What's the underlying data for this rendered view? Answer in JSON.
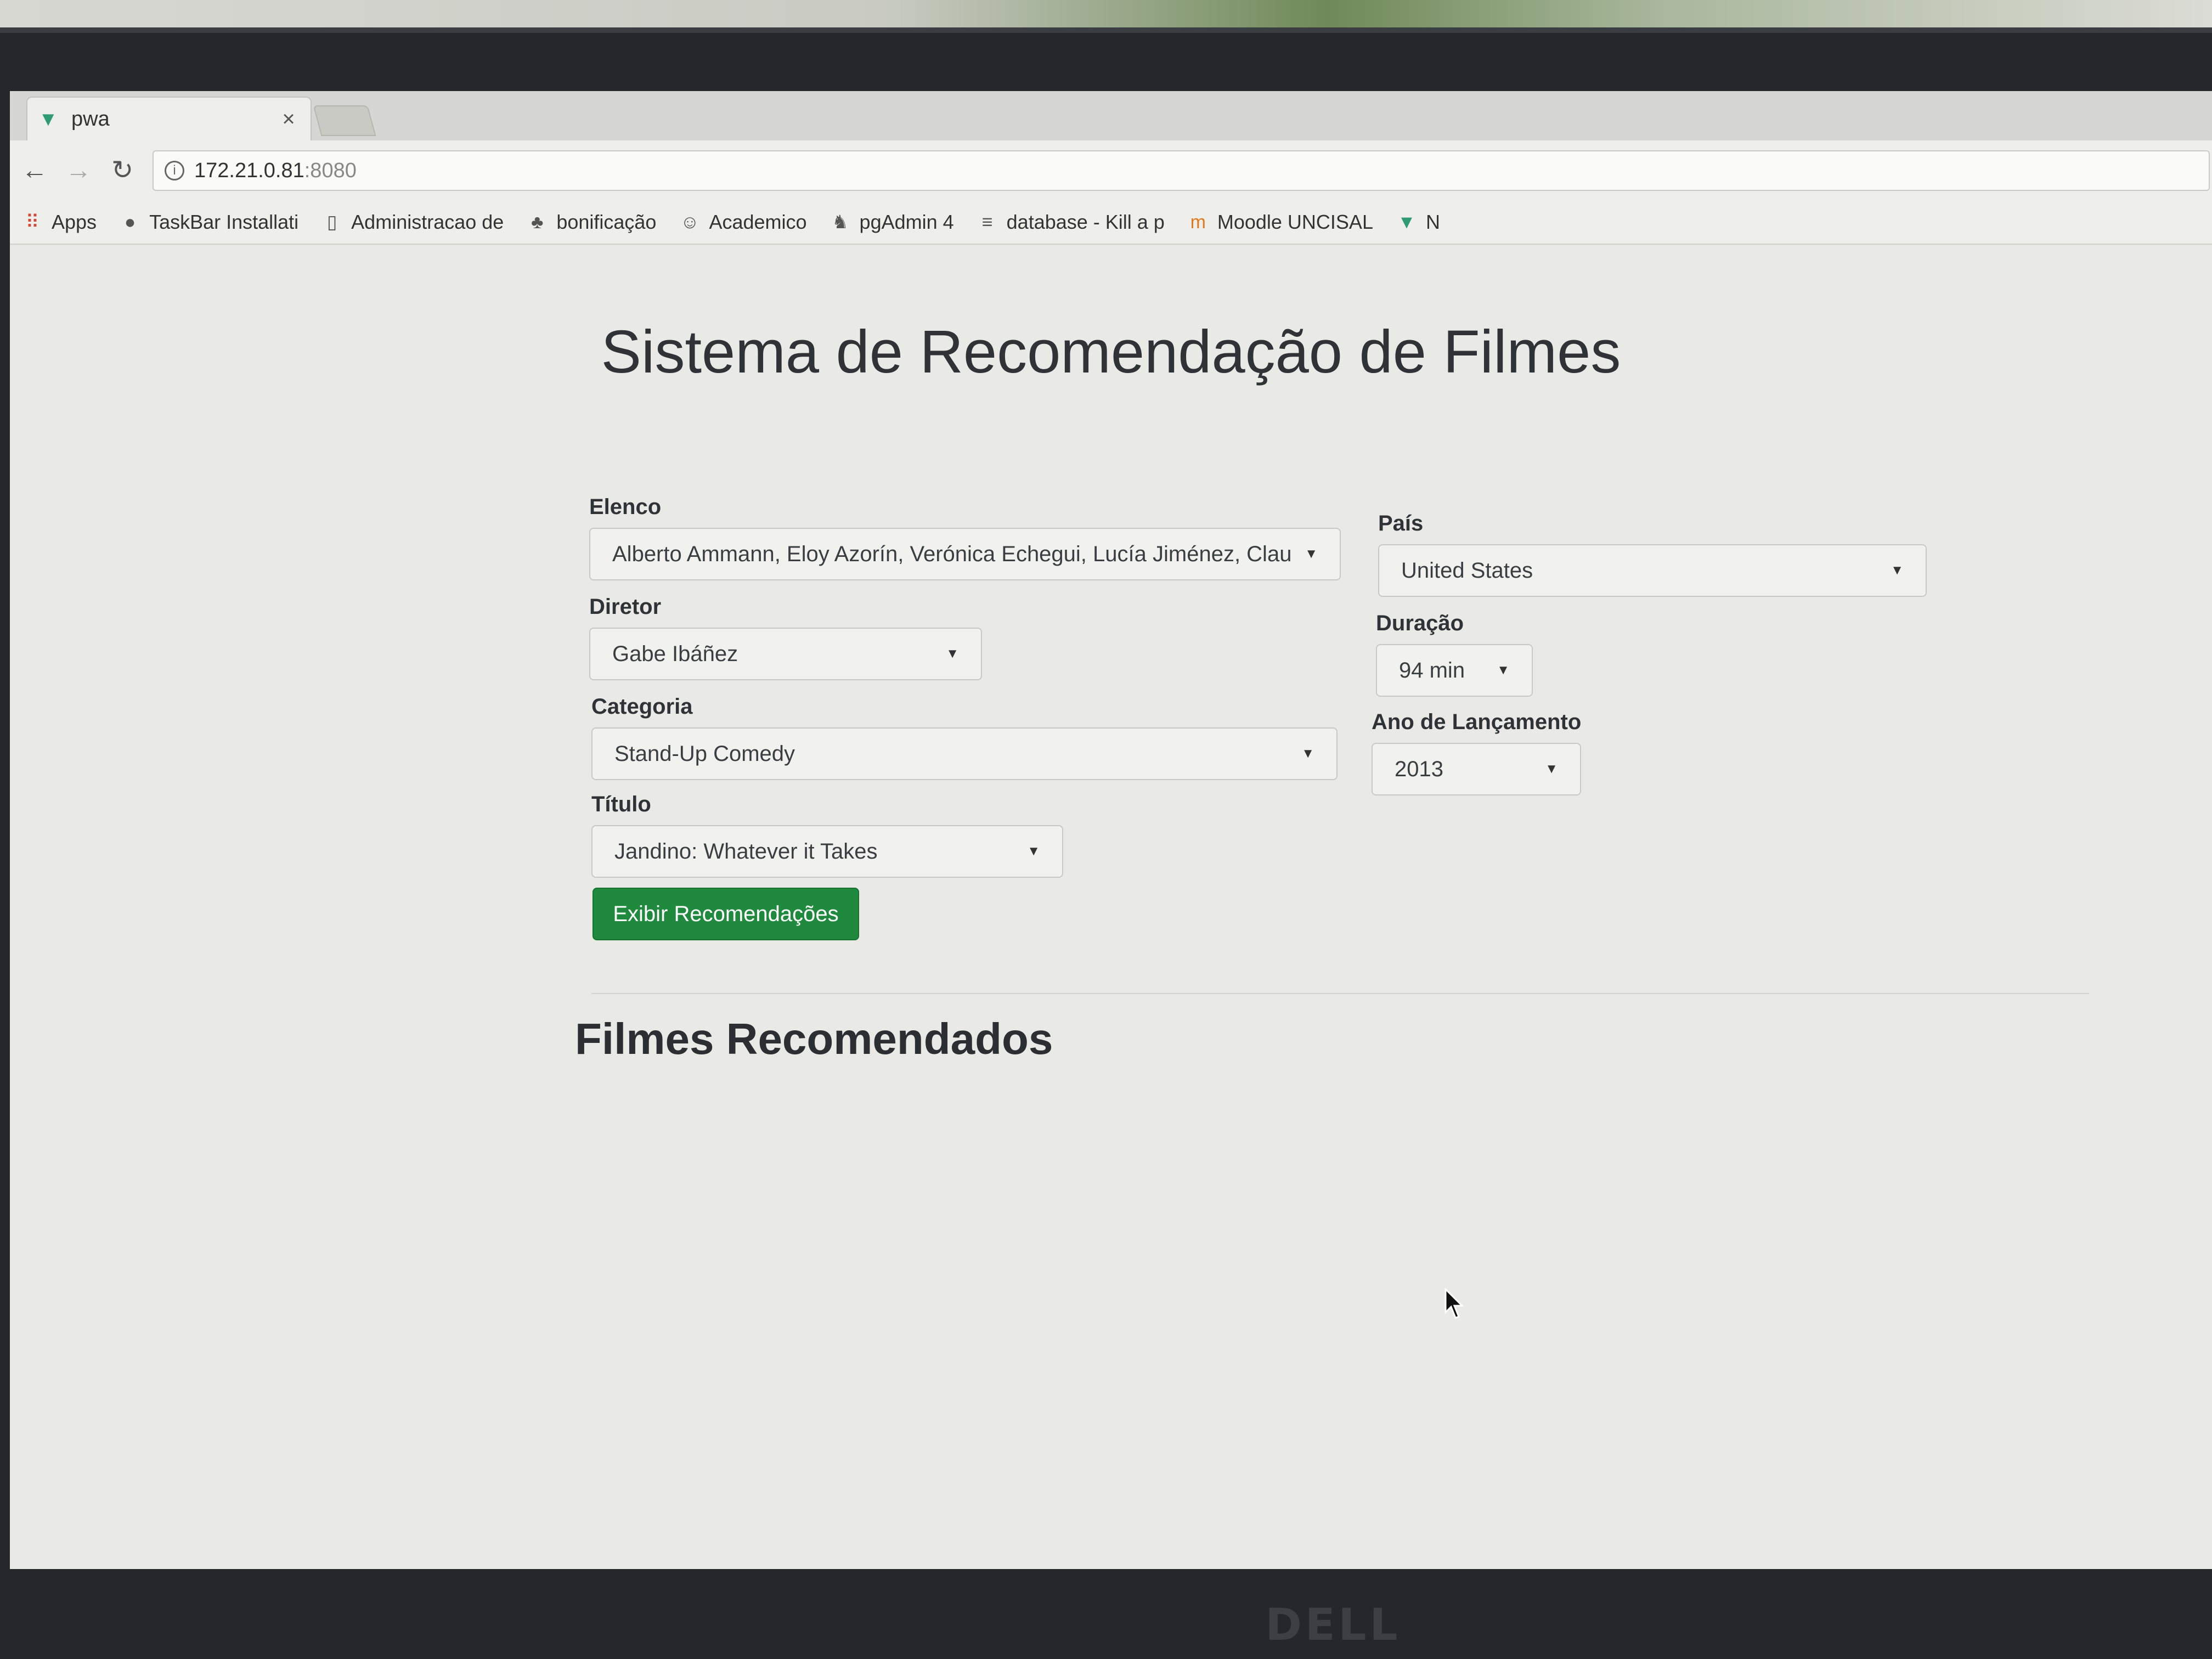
{
  "browser": {
    "tab": {
      "title": "pwa",
      "close": "×"
    },
    "address": {
      "host": "172.21.0.81",
      "port": ":8080"
    },
    "bookmarks": [
      {
        "label": "Apps",
        "icon": "apps-grid-icon"
      },
      {
        "label": "TaskBar Installati",
        "icon": "github-icon"
      },
      {
        "label": "Administracao de",
        "icon": "page-icon"
      },
      {
        "label": "bonificação",
        "icon": "bonus-icon"
      },
      {
        "label": "Academico",
        "icon": "academico-icon"
      },
      {
        "label": "pgAdmin 4",
        "icon": "elephant-icon"
      },
      {
        "label": "database - Kill a p",
        "icon": "stackoverflow-icon"
      },
      {
        "label": "Moodle UNCISAL",
        "icon": "moodle-icon"
      },
      {
        "label": "N",
        "icon": "vue-icon"
      }
    ]
  },
  "page": {
    "title": "Sistema de Recomendação de Filmes",
    "form": {
      "elenco": {
        "label": "Elenco",
        "value": "Alberto Ammann, Eloy Azorín, Verónica Echegui, Lucía Jiménez, Clau"
      },
      "diretor": {
        "label": "Diretor",
        "value": "Gabe Ibáñez"
      },
      "categoria": {
        "label": "Categoria",
        "value": "Stand-Up Comedy"
      },
      "titulo": {
        "label": "Título",
        "value": "Jandino: Whatever it Takes"
      },
      "pais": {
        "label": "País",
        "value": "United States"
      },
      "duracao": {
        "label": "Duração",
        "value": "94 min"
      },
      "ano": {
        "label": "Ano de Lançamento",
        "value": "2013"
      },
      "submit_label": "Exibir Recomendações"
    },
    "results_title": "Filmes Recomendados"
  },
  "monitor": {
    "brand": "DELL"
  },
  "colors": {
    "primary_button": "#1f8a3d",
    "page_bg": "#e9eae5"
  }
}
